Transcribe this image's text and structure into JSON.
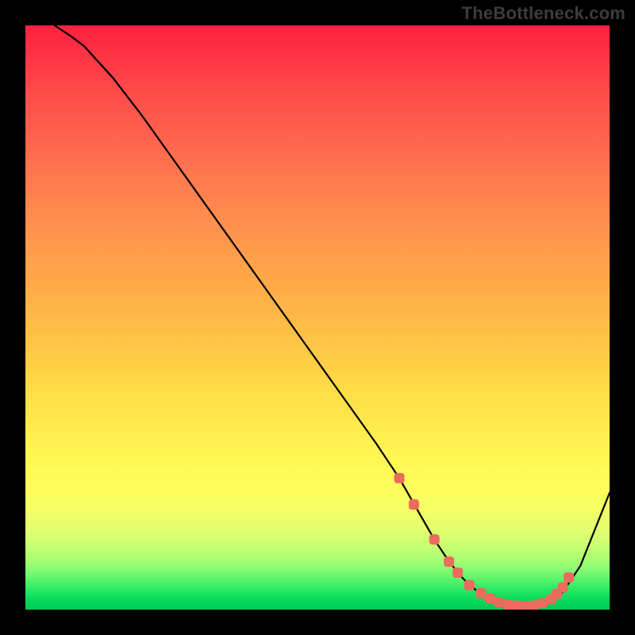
{
  "watermark": "TheBottleneck.com",
  "chart_data": {
    "type": "line",
    "title": "",
    "xlabel": "",
    "ylabel": "",
    "xlim": [
      0,
      100
    ],
    "ylim": [
      0,
      100
    ],
    "series": [
      {
        "name": "curve",
        "x": [
          5,
          8,
          10,
          15,
          20,
          25,
          30,
          35,
          40,
          45,
          50,
          55,
          60,
          62,
          64,
          66,
          68,
          70,
          72,
          74,
          76,
          78,
          80,
          82,
          84,
          85,
          86,
          88,
          90,
          92,
          95,
          100
        ],
        "y": [
          100,
          98,
          96.5,
          91,
          84.5,
          77.5,
          70.5,
          63.5,
          56.5,
          49.5,
          42.5,
          35.5,
          28.5,
          25.5,
          22.5,
          19,
          15.5,
          12,
          9,
          6.3,
          4.2,
          2.7,
          1.7,
          1.1,
          0.7,
          0.6,
          0.6,
          0.8,
          1.4,
          3.0,
          7.5,
          20
        ]
      }
    ],
    "markers": [
      {
        "x": 64,
        "y": 22.5
      },
      {
        "x": 66.5,
        "y": 18
      },
      {
        "x": 70,
        "y": 12
      },
      {
        "x": 72.5,
        "y": 8.2
      },
      {
        "x": 74,
        "y": 6.3
      },
      {
        "x": 76,
        "y": 4.2
      },
      {
        "x": 78,
        "y": 2.8
      },
      {
        "x": 79.5,
        "y": 1.9
      },
      {
        "x": 81,
        "y": 1.3
      },
      {
        "x": 82.5,
        "y": 0.9
      },
      {
        "x": 84,
        "y": 0.7
      },
      {
        "x": 85.5,
        "y": 0.6
      },
      {
        "x": 87,
        "y": 0.7
      },
      {
        "x": 88.5,
        "y": 1.1
      },
      {
        "x": 90,
        "y": 1.8
      },
      {
        "x": 91,
        "y": 2.7
      },
      {
        "x": 92,
        "y": 3.8
      },
      {
        "x": 93,
        "y": 5.5
      }
    ],
    "gradient_stops": [
      {
        "pos": 0.0,
        "color": "#ff203f"
      },
      {
        "pos": 0.25,
        "color": "#ff764f"
      },
      {
        "pos": 0.5,
        "color": "#ffb647"
      },
      {
        "pos": 0.73,
        "color": "#fff551"
      },
      {
        "pos": 0.86,
        "color": "#e4ff6d"
      },
      {
        "pos": 0.95,
        "color": "#4ff26a"
      },
      {
        "pos": 1.0,
        "color": "#00ca54"
      }
    ],
    "marker_color": "#ed6a5e",
    "line_color": "#000000"
  }
}
